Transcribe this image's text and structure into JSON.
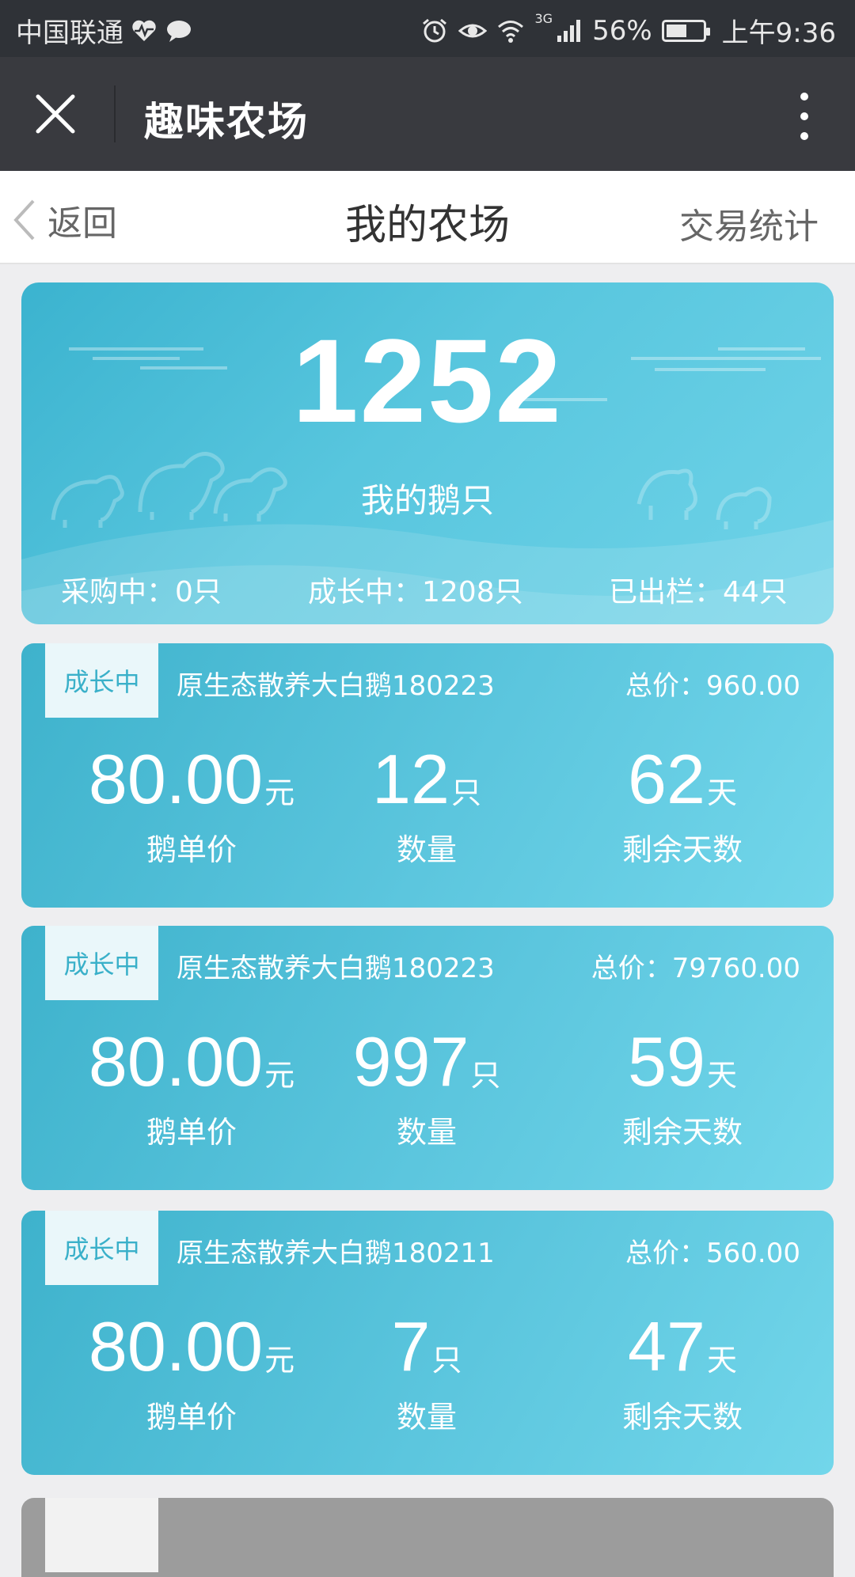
{
  "status_bar": {
    "carrier": "中国联通",
    "network": "3G",
    "battery": "56%",
    "battery_level": 0.56,
    "time": "上午9:36"
  },
  "wechat_bar": {
    "title": "趣味农场"
  },
  "page_header": {
    "back_label": "返回",
    "title": "我的农场",
    "right_link": "交易统计"
  },
  "summary": {
    "total": "1252",
    "label": "我的鹅只",
    "purchasing": "采购中：0只",
    "growing": "成长中：1208只",
    "sold": "已出栏：44只"
  },
  "orders": [
    {
      "status": "成长中",
      "name": "原生态散养大白鹅180223",
      "total": "总价：960.00",
      "price": "80.00",
      "price_unit": "元",
      "price_label": "鹅单价",
      "qty": "12",
      "qty_unit": "只",
      "qty_label": "数量",
      "days": "62",
      "days_unit": "天",
      "days_label": "剩余天数"
    },
    {
      "status": "成长中",
      "name": "原生态散养大白鹅180223",
      "total": "总价：79760.00",
      "price": "80.00",
      "price_unit": "元",
      "price_label": "鹅单价",
      "qty": "997",
      "qty_unit": "只",
      "qty_label": "数量",
      "days": "59",
      "days_unit": "天",
      "days_label": "剩余天数"
    },
    {
      "status": "成长中",
      "name": "原生态散养大白鹅180211",
      "total": "总价：560.00",
      "price": "80.00",
      "price_unit": "元",
      "price_label": "鹅单价",
      "qty": "7",
      "qty_unit": "只",
      "qty_label": "数量",
      "days": "47",
      "days_unit": "天",
      "days_label": "剩余天数"
    }
  ],
  "colors": {
    "status_bar": "#2f3237",
    "wechat_bar": "#393a3f",
    "card_accent": "#4fc0da",
    "tag_text": "#3ab0c9"
  }
}
